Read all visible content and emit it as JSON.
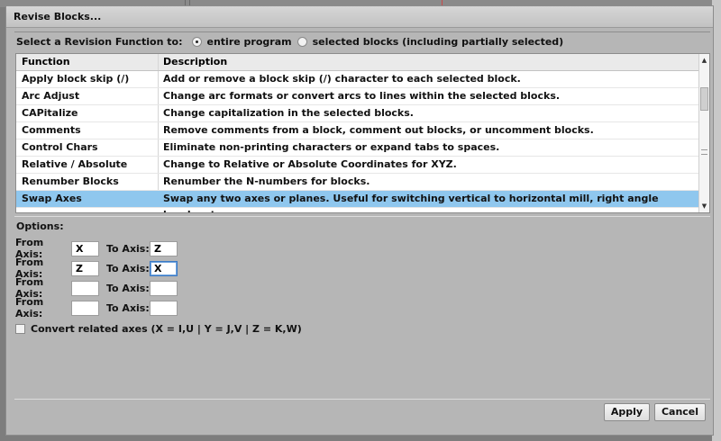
{
  "window": {
    "title": "Revise Blocks..."
  },
  "revision_function": {
    "label": "Select a Revision Function to:",
    "options": [
      {
        "label": "entire program",
        "selected": true
      },
      {
        "label": "selected blocks (including partially selected)",
        "selected": false
      }
    ]
  },
  "table": {
    "columns": [
      "Function",
      "Description"
    ],
    "rows": [
      {
        "function": "Apply block skip (/)",
        "description": "Add or remove a block skip (/) character to each selected block."
      },
      {
        "function": "Arc Adjust",
        "description": "Change arc formats or convert arcs to lines within the selected blocks."
      },
      {
        "function": "CAPitalize",
        "description": "Change capitalization in the selected blocks."
      },
      {
        "function": "Comments",
        "description": "Remove comments from a block, comment out blocks, or uncomment blocks."
      },
      {
        "function": "Control Chars",
        "description": "Eliminate non-printing characters or expand tabs to spaces."
      },
      {
        "function": "Relative / Absolute",
        "description": "Change to Relative or Absolute Coordinates for XYZ."
      },
      {
        "function": "Renumber Blocks",
        "description": "Renumber the N-numbers for blocks."
      },
      {
        "function": "Swap Axes",
        "description": "Swap any two axes or planes. Useful for switching vertical to horizontal mill, right angle heads, etc."
      }
    ],
    "selected_row": "Swap Axes"
  },
  "options": {
    "label": "Options:",
    "from_label": "From Axis:",
    "to_label": "To Axis:",
    "axes": [
      {
        "from": "X",
        "to": "Z"
      },
      {
        "from": "Z",
        "to": "X"
      },
      {
        "from": "",
        "to": ""
      },
      {
        "from": "",
        "to": ""
      }
    ],
    "convert_related": {
      "label": "Convert related axes (X = I,U | Y = J,V | Z = K,W)",
      "checked": false
    }
  },
  "buttons": {
    "apply": "Apply",
    "cancel": "Cancel"
  }
}
